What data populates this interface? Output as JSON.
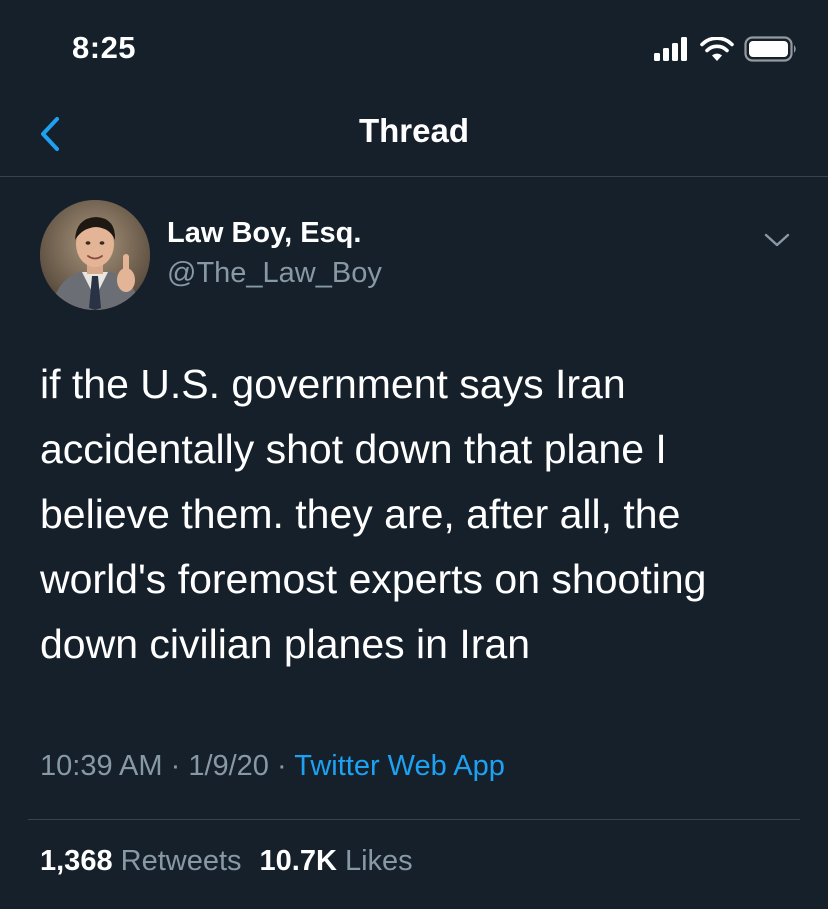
{
  "status_bar": {
    "time": "8:25",
    "icons": [
      "cellular-signal-icon",
      "wifi-icon",
      "battery-icon"
    ]
  },
  "nav": {
    "title": "Thread",
    "back_icon": "chevron-left-icon"
  },
  "tweet": {
    "author": {
      "name": "Law Boy, Esq.",
      "handle": "@The_Law_Boy",
      "avatar": "avatar-photo"
    },
    "more_icon": "chevron-down-icon",
    "text": "if the U.S. government says Iran\naccidentally shot down that plane I\nbelieve them. they are, after all, the\nworld's foremost experts on shooting\ndown civilian planes in Iran",
    "meta": {
      "time": "10:39 AM",
      "separator": " · ",
      "date": "1/9/20",
      "source": "Twitter Web App"
    },
    "stats": {
      "retweets_count": "1,368",
      "retweets_label": "Retweets",
      "likes_count": "10.7K",
      "likes_label": "Likes"
    }
  },
  "colors": {
    "background": "#15202b",
    "accent": "#1da1f2",
    "secondary_text": "#8899a6",
    "divider": "#38444d"
  }
}
